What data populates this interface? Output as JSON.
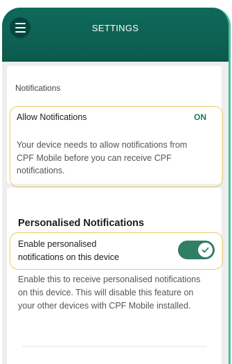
{
  "header": {
    "title": "SETTINGS",
    "menu_icon": "hamburger-menu-icon"
  },
  "notifications": {
    "section_label": "Notifications",
    "allow_label": "Allow Notifications",
    "allow_status": "ON",
    "allow_description": "Your device needs to allow notifications from CPF Mobile before you can receive CPF notifications."
  },
  "personalised": {
    "title": "Personalised Notifications",
    "enable_label": "Enable personalised notifications on this device",
    "enabled": true,
    "description": "Enable this to receive personalised notifications on this device. This will disable this feature on your other devices with CPF Mobile installed."
  },
  "colors": {
    "header": "#0f6a5b",
    "accent": "#2f7e66",
    "highlight": "#e6cc6a"
  }
}
